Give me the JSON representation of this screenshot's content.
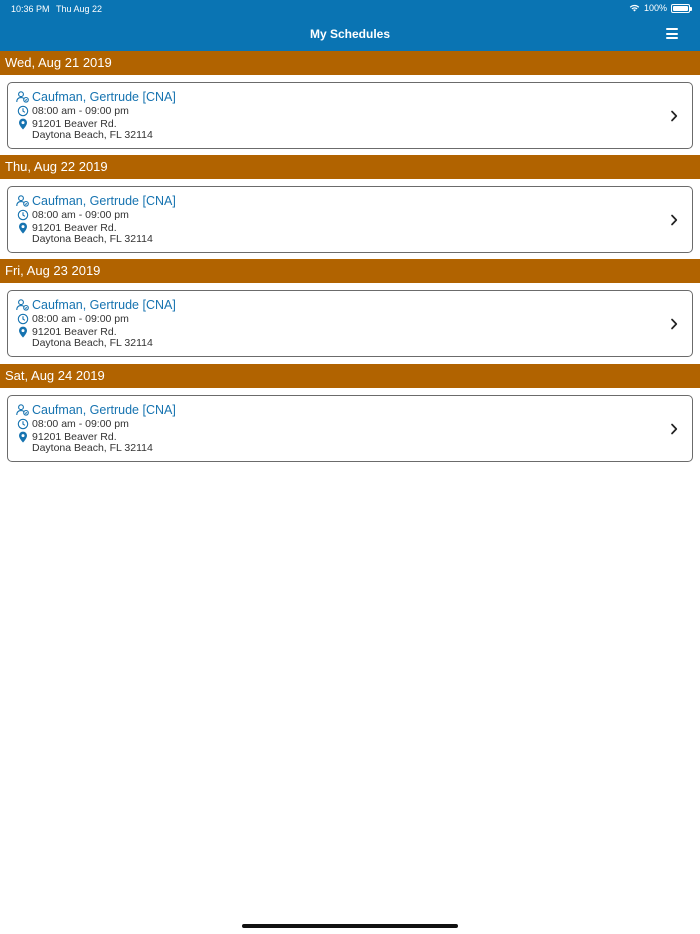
{
  "status_bar": {
    "time": "10:36 PM",
    "date": "Thu Aug 22",
    "battery": "100%"
  },
  "nav": {
    "title": "My Schedules",
    "menu_icon": "hamburger-menu-icon"
  },
  "colors": {
    "nav_bg": "#0a74b3",
    "day_header_bg": "#b16300",
    "name_text": "#1673b0"
  },
  "schedule": [
    {
      "day": "Wed, Aug 21 2019",
      "client": "Caufman, Gertrude [CNA]",
      "time": "08:00 am - 09:00 pm",
      "address_line1": "91201 Beaver Rd.",
      "address_line2": "Daytona Beach, FL 32114"
    },
    {
      "day": "Thu, Aug 22 2019",
      "client": "Caufman, Gertrude [CNA]",
      "time": "08:00 am - 09:00 pm",
      "address_line1": "91201 Beaver Rd.",
      "address_line2": "Daytona Beach, FL 32114"
    },
    {
      "day": "Fri, Aug 23 2019",
      "client": "Caufman, Gertrude [CNA]",
      "time": "08:00 am - 09:00 pm",
      "address_line1": "91201 Beaver Rd.",
      "address_line2": "Daytona Beach, FL 32114"
    },
    {
      "day": "Sat, Aug 24 2019",
      "client": "Caufman, Gertrude [CNA]",
      "time": "08:00 am - 09:00 pm",
      "address_line1": "91201 Beaver Rd.",
      "address_line2": "Daytona Beach, FL 32114"
    }
  ]
}
